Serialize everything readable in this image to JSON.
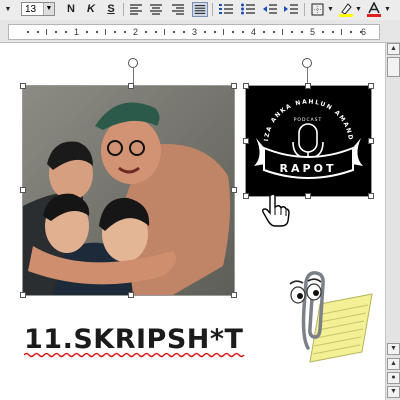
{
  "toolbar": {
    "font_size": "13",
    "bold": "N",
    "italic": "K",
    "underline": "S"
  },
  "ruler": {
    "numbers": [
      "1",
      "2",
      "3",
      "4",
      "5",
      "6"
    ]
  },
  "document": {
    "title_text": "11.SKRIPSH*T",
    "logo": {
      "arc_text": "RIZA ANKA NAHLUN AMANDA",
      "sub_text": "PODCAST",
      "banner_text": "RAPOT"
    }
  },
  "colors": {
    "highlight_bar": "#ffff00",
    "font_color_bar": "#e02020",
    "logo_bg": "#000000",
    "spellcheck": "#d81818"
  },
  "icons": {
    "cursor": "hand-pointer-icon",
    "assistant": "office-paperclip-assistant-icon"
  }
}
